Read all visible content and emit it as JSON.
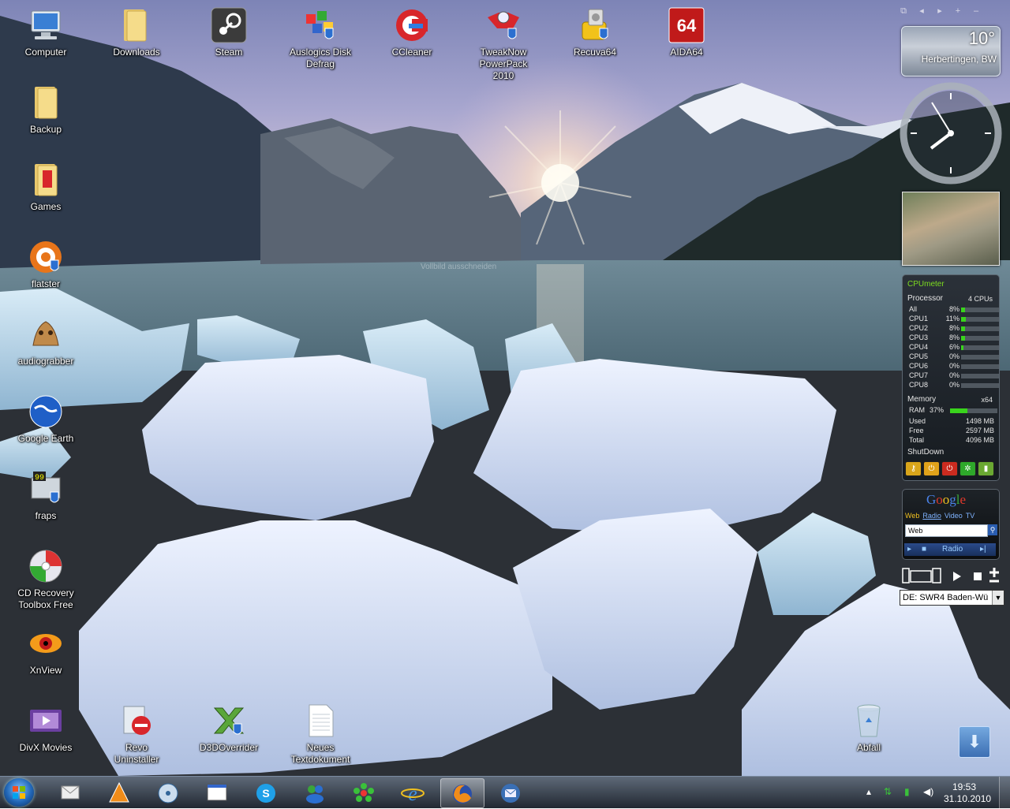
{
  "desktop_icons": [
    {
      "id": "computer",
      "label": "Computer",
      "icon": "computer-icon"
    },
    {
      "id": "downloads",
      "label": "Downloads",
      "icon": "folder-icon"
    },
    {
      "id": "steam",
      "label": "Steam",
      "icon": "steam-icon"
    },
    {
      "id": "auslogics",
      "label": "Auslogics Disk\nDefrag",
      "icon": "defrag-icon"
    },
    {
      "id": "ccleaner",
      "label": "CCleaner",
      "icon": "ccleaner-icon"
    },
    {
      "id": "tweaknow",
      "label": "TweakNow\nPowerPack 2010",
      "icon": "tweaknow-icon"
    },
    {
      "id": "recuva",
      "label": "Recuva64",
      "icon": "recuva-icon"
    },
    {
      "id": "aida",
      "label": "AIDA64",
      "icon": "aida64-icon"
    },
    {
      "id": "backup",
      "label": "Backup",
      "icon": "folder-icon"
    },
    {
      "id": "games",
      "label": "Games",
      "icon": "games-folder-icon"
    },
    {
      "id": "flatster",
      "label": "flatster",
      "icon": "flatster-icon"
    },
    {
      "id": "audiograbber",
      "label": "audiograbber",
      "icon": "audiograbber-icon"
    },
    {
      "id": "googleearth",
      "label": "Google Earth",
      "icon": "google-earth-icon"
    },
    {
      "id": "fraps",
      "label": "fraps",
      "icon": "fraps-icon"
    },
    {
      "id": "cdrecovery",
      "label": "CD Recovery\nToolbox Free",
      "icon": "cd-recovery-icon"
    },
    {
      "id": "xnview",
      "label": "XnView",
      "icon": "xnview-icon"
    },
    {
      "id": "divx",
      "label": "DivX Movies",
      "icon": "divx-icon"
    },
    {
      "id": "revo",
      "label": "Revo Uninstaller",
      "icon": "revo-uninstaller-icon"
    },
    {
      "id": "d3d",
      "label": "D3DOverrider",
      "icon": "d3doverrider-icon"
    },
    {
      "id": "textdoc",
      "label": "Neues\nTextdokument",
      "icon": "text-document-icon"
    },
    {
      "id": "recycle",
      "label": "Abfall",
      "icon": "recycle-bin-icon"
    }
  ],
  "weather": {
    "temperature": "10°",
    "location": "Herbertingen, BW"
  },
  "wallpaper_hint": "Vollbild ausschneiden",
  "cpumeter": {
    "title": "CPUmeter",
    "processor_label": "Processor",
    "cpu_count": "4 CPUs",
    "rows": [
      {
        "name": "All",
        "pct": "8%",
        "value": 0.08
      },
      {
        "name": "CPU1",
        "pct": "11%",
        "value": 0.11
      },
      {
        "name": "CPU2",
        "pct": "8%",
        "value": 0.08
      },
      {
        "name": "CPU3",
        "pct": "8%",
        "value": 0.08
      },
      {
        "name": "CPU4",
        "pct": "6%",
        "value": 0.06
      },
      {
        "name": "CPU5",
        "pct": "0%",
        "value": 0
      },
      {
        "name": "CPU6",
        "pct": "0%",
        "value": 0
      },
      {
        "name": "CPU7",
        "pct": "0%",
        "value": 0
      },
      {
        "name": "CPU8",
        "pct": "0%",
        "value": 0
      }
    ],
    "memory_label": "Memory",
    "arch": "x64",
    "ram_label": "RAM",
    "ram_pct": "37%",
    "ram_value": 0.37,
    "used_label": "Used",
    "used": "1498 MB",
    "free_label": "Free",
    "free": "2597 MB",
    "total_label": "Total",
    "total": "4096 MB",
    "shutdown_label": "ShutDown"
  },
  "google_gadget": {
    "logo": "Google",
    "tabs": [
      "Web",
      "Radio",
      "Video",
      "TV"
    ],
    "search_value": "Web",
    "player_label": "Radio"
  },
  "radio": {
    "station": "DE: SWR4 Baden-Wü"
  },
  "taskbar": {
    "apps": [
      "mail-icon",
      "vlc-icon",
      "cd-burner-icon",
      "window-icon",
      "skype-icon",
      "messenger-icon",
      "icq-icon",
      "internet-explorer-icon",
      "firefox-icon",
      "thunderbird-icon"
    ],
    "active_app": "firefox-icon",
    "time": "19:53",
    "date": "31.10.2010"
  },
  "colors": {
    "cpu_bar": "#39d41c",
    "cpumeter_title": "#7ddc1f",
    "google_tab": "#f0c020"
  }
}
